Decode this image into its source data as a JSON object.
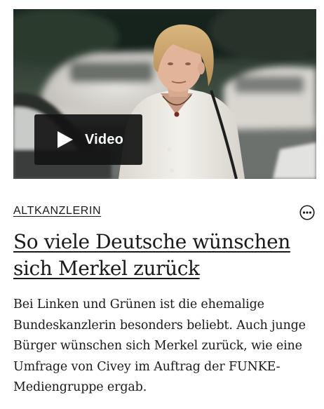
{
  "article": {
    "video_label": "Video",
    "kicker": "ALTKANZLERIN",
    "headline": "So viele Deutsche wünschen sich Merkel zurück",
    "lead": "Bei Linken und Grünen ist die ehemalige Bundeskanzlerin besonders beliebt. Auch junge Bürger wünschen sich Merkel zurück, wie eine Umfrage von Civey im Auftrag der FUNKE-Mediengruppe ergab."
  },
  "icons": {
    "play": "play-icon",
    "more": "more-options-icon"
  },
  "colors": {
    "text": "#1a1a1a",
    "video_badge_bg": "#141414",
    "video_label": "#ffffff"
  }
}
